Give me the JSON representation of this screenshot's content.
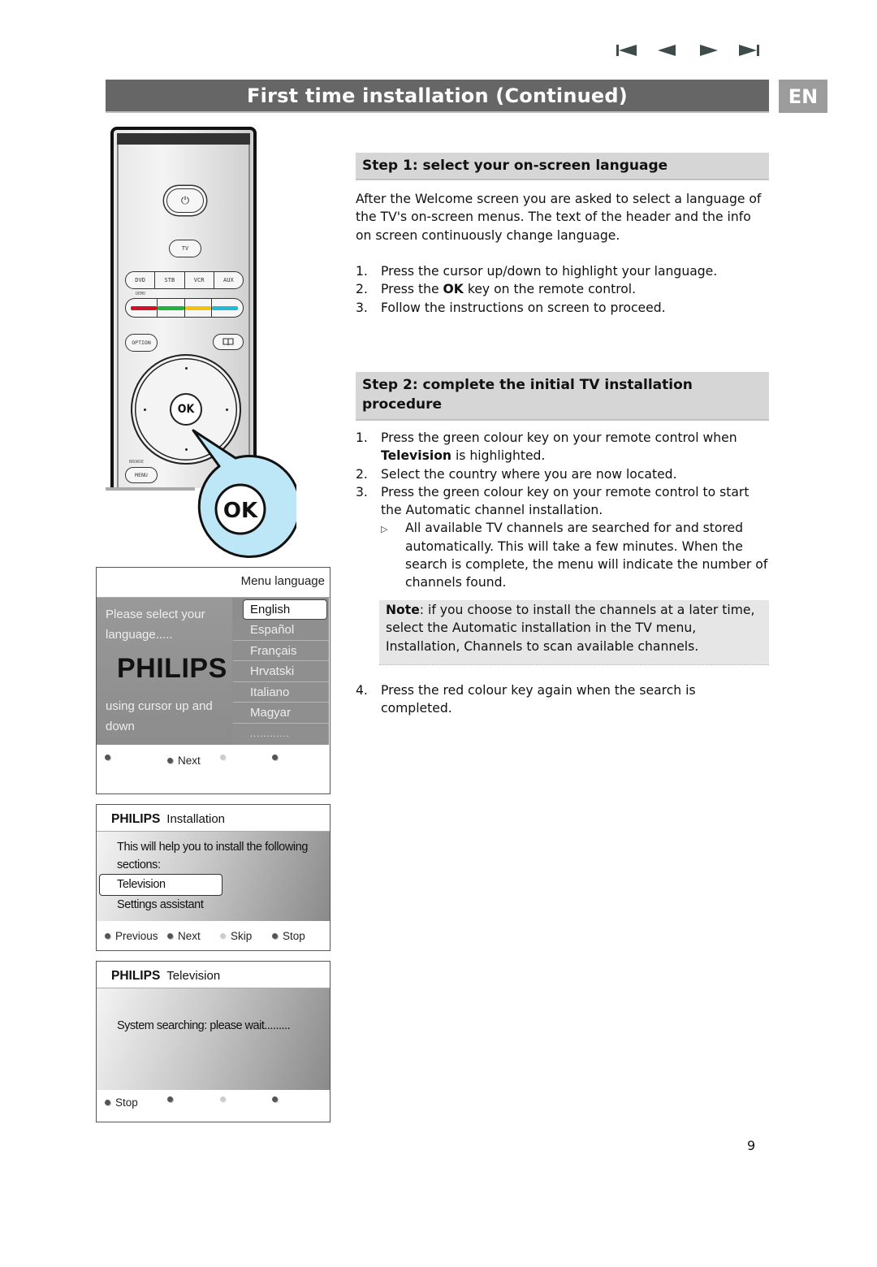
{
  "nav": {
    "icons": [
      "first-page-icon",
      "previous-page-icon",
      "next-page-icon",
      "last-page-icon"
    ]
  },
  "header": {
    "title": "First time installation  (Continued)",
    "language_badge": "EN"
  },
  "colors": {
    "title_bar": "#666666",
    "badge": "#9c9c9c",
    "step_header": "#d6d6d6",
    "note_bg": "#e6e6e6",
    "callout": "#bde6f6",
    "key_red": "#d0122a",
    "key_green": "#22b33a",
    "key_yellow": "#f4c20d",
    "key_cyan": "#21b9d3"
  },
  "remote": {
    "power_symbol": "⏻",
    "tv_label": "TV",
    "source_keys": [
      "DVD",
      "STB",
      "VCR",
      "AUX"
    ],
    "demo_label": "DEMO",
    "option_label": "OPTION",
    "guide_symbol": "📖",
    "ok_label": "OK",
    "browse_label": "BROWSE",
    "menu_label": "MENU",
    "callout_label": "OK"
  },
  "screen_language": {
    "header": "Menu language",
    "prompt_line1": "Please select your",
    "prompt_line2": "language.....",
    "brand": "PHILIPS",
    "hint_line1": "using cursor up and",
    "hint_line2": "down",
    "languages": [
      "English",
      "Español",
      "Français",
      "Hrvatski",
      "Italiano",
      "Magyar",
      "............"
    ],
    "selected": "English",
    "footer": [
      "",
      "Next",
      "",
      ""
    ]
  },
  "screen_installation": {
    "brand": "PHILIPS",
    "title": "Installation",
    "intro": "This will help you to install the following sections:",
    "items": [
      "Television",
      "Settings assistant"
    ],
    "selected": "Television",
    "footer": [
      "Previous",
      "Next",
      "Skip",
      "Stop"
    ]
  },
  "screen_television": {
    "brand": "PHILIPS",
    "title": "Television",
    "message": "System searching: please wait.........",
    "footer": [
      "Stop",
      "",
      "",
      ""
    ]
  },
  "step1": {
    "heading": "Step 1: select your on-screen language",
    "intro": "After the Welcome screen you are asked to select a language of the TV's on-screen menus. The text of the header and the info on screen continuously change language.",
    "items": [
      {
        "n": "1.",
        "pre": "Press the cursor up/down to highlight your language.",
        "bold": "",
        "post": ""
      },
      {
        "n": "2.",
        "pre": "Press the ",
        "bold": "OK",
        "post": " key on the remote control."
      },
      {
        "n": "3.",
        "pre": "Follow the instructions on screen to proceed.",
        "bold": "",
        "post": ""
      }
    ]
  },
  "step2": {
    "heading": "Step 2: complete the initial TV installation procedure",
    "items": [
      {
        "n": "1.",
        "pre": "Press the green colour key on your remote control when ",
        "bold": "Television",
        "post": " is highlighted."
      },
      {
        "n": "2.",
        "pre": "Select the country where you are now located.",
        "bold": "",
        "post": ""
      },
      {
        "n": "3.",
        "pre": "Press the green colour key on your remote control to start the Automatic channel installation.",
        "bold": "",
        "post": ""
      }
    ],
    "sub_note": "All available TV channels are searched for and stored automatically. This will take a few minutes. When the search is complete, the menu will indicate the number of channels found.",
    "note_label": "Note",
    "note_text": ": if you choose to install the channels at a later time, select the Automatic installation in the TV menu, Installation, Channels to scan available channels.",
    "item4": {
      "n": "4.",
      "text": "Press the red colour key again when the search is completed."
    }
  },
  "page_number": "9"
}
